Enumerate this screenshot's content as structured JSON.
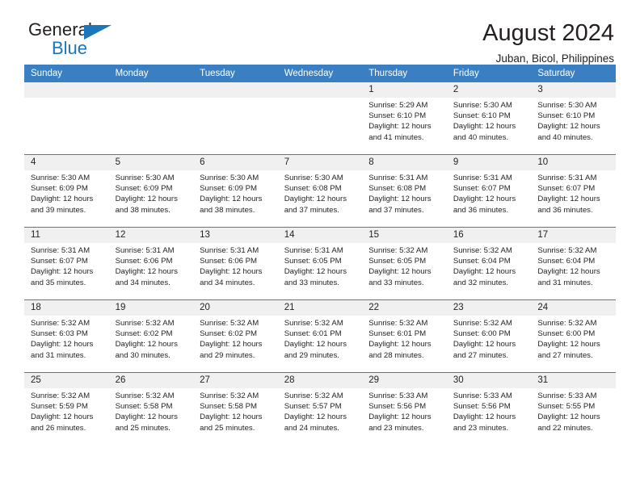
{
  "brand": {
    "name_primary": "General",
    "name_secondary": "Blue",
    "triangle_icon": "brand-triangle-icon",
    "accent_color": "#1b76bc"
  },
  "header": {
    "title": "August 2024",
    "subtitle": "Juban, Bicol, Philippines"
  },
  "calendar": {
    "header_color": "#3a7fc1",
    "daynum_band_color": "#f0f0f0",
    "weekday_headers": [
      "Sunday",
      "Monday",
      "Tuesday",
      "Wednesday",
      "Thursday",
      "Friday",
      "Saturday"
    ],
    "weeks": [
      [
        {
          "day": "",
          "blank": true,
          "sunrise": "",
          "sunset": "",
          "daylight_1": "",
          "daylight_2": ""
        },
        {
          "day": "",
          "blank": true,
          "sunrise": "",
          "sunset": "",
          "daylight_1": "",
          "daylight_2": ""
        },
        {
          "day": "",
          "blank": true,
          "sunrise": "",
          "sunset": "",
          "daylight_1": "",
          "daylight_2": ""
        },
        {
          "day": "",
          "blank": true,
          "sunrise": "",
          "sunset": "",
          "daylight_1": "",
          "daylight_2": ""
        },
        {
          "day": "1",
          "blank": false,
          "sunrise": "Sunrise: 5:29 AM",
          "sunset": "Sunset: 6:10 PM",
          "daylight_1": "Daylight: 12 hours",
          "daylight_2": "and 41 minutes."
        },
        {
          "day": "2",
          "blank": false,
          "sunrise": "Sunrise: 5:30 AM",
          "sunset": "Sunset: 6:10 PM",
          "daylight_1": "Daylight: 12 hours",
          "daylight_2": "and 40 minutes."
        },
        {
          "day": "3",
          "blank": false,
          "sunrise": "Sunrise: 5:30 AM",
          "sunset": "Sunset: 6:10 PM",
          "daylight_1": "Daylight: 12 hours",
          "daylight_2": "and 40 minutes."
        }
      ],
      [
        {
          "day": "4",
          "blank": false,
          "sunrise": "Sunrise: 5:30 AM",
          "sunset": "Sunset: 6:09 PM",
          "daylight_1": "Daylight: 12 hours",
          "daylight_2": "and 39 minutes."
        },
        {
          "day": "5",
          "blank": false,
          "sunrise": "Sunrise: 5:30 AM",
          "sunset": "Sunset: 6:09 PM",
          "daylight_1": "Daylight: 12 hours",
          "daylight_2": "and 38 minutes."
        },
        {
          "day": "6",
          "blank": false,
          "sunrise": "Sunrise: 5:30 AM",
          "sunset": "Sunset: 6:09 PM",
          "daylight_1": "Daylight: 12 hours",
          "daylight_2": "and 38 minutes."
        },
        {
          "day": "7",
          "blank": false,
          "sunrise": "Sunrise: 5:30 AM",
          "sunset": "Sunset: 6:08 PM",
          "daylight_1": "Daylight: 12 hours",
          "daylight_2": "and 37 minutes."
        },
        {
          "day": "8",
          "blank": false,
          "sunrise": "Sunrise: 5:31 AM",
          "sunset": "Sunset: 6:08 PM",
          "daylight_1": "Daylight: 12 hours",
          "daylight_2": "and 37 minutes."
        },
        {
          "day": "9",
          "blank": false,
          "sunrise": "Sunrise: 5:31 AM",
          "sunset": "Sunset: 6:07 PM",
          "daylight_1": "Daylight: 12 hours",
          "daylight_2": "and 36 minutes."
        },
        {
          "day": "10",
          "blank": false,
          "sunrise": "Sunrise: 5:31 AM",
          "sunset": "Sunset: 6:07 PM",
          "daylight_1": "Daylight: 12 hours",
          "daylight_2": "and 36 minutes."
        }
      ],
      [
        {
          "day": "11",
          "blank": false,
          "sunrise": "Sunrise: 5:31 AM",
          "sunset": "Sunset: 6:07 PM",
          "daylight_1": "Daylight: 12 hours",
          "daylight_2": "and 35 minutes."
        },
        {
          "day": "12",
          "blank": false,
          "sunrise": "Sunrise: 5:31 AM",
          "sunset": "Sunset: 6:06 PM",
          "daylight_1": "Daylight: 12 hours",
          "daylight_2": "and 34 minutes."
        },
        {
          "day": "13",
          "blank": false,
          "sunrise": "Sunrise: 5:31 AM",
          "sunset": "Sunset: 6:06 PM",
          "daylight_1": "Daylight: 12 hours",
          "daylight_2": "and 34 minutes."
        },
        {
          "day": "14",
          "blank": false,
          "sunrise": "Sunrise: 5:31 AM",
          "sunset": "Sunset: 6:05 PM",
          "daylight_1": "Daylight: 12 hours",
          "daylight_2": "and 33 minutes."
        },
        {
          "day": "15",
          "blank": false,
          "sunrise": "Sunrise: 5:32 AM",
          "sunset": "Sunset: 6:05 PM",
          "daylight_1": "Daylight: 12 hours",
          "daylight_2": "and 33 minutes."
        },
        {
          "day": "16",
          "blank": false,
          "sunrise": "Sunrise: 5:32 AM",
          "sunset": "Sunset: 6:04 PM",
          "daylight_1": "Daylight: 12 hours",
          "daylight_2": "and 32 minutes."
        },
        {
          "day": "17",
          "blank": false,
          "sunrise": "Sunrise: 5:32 AM",
          "sunset": "Sunset: 6:04 PM",
          "daylight_1": "Daylight: 12 hours",
          "daylight_2": "and 31 minutes."
        }
      ],
      [
        {
          "day": "18",
          "blank": false,
          "sunrise": "Sunrise: 5:32 AM",
          "sunset": "Sunset: 6:03 PM",
          "daylight_1": "Daylight: 12 hours",
          "daylight_2": "and 31 minutes."
        },
        {
          "day": "19",
          "blank": false,
          "sunrise": "Sunrise: 5:32 AM",
          "sunset": "Sunset: 6:02 PM",
          "daylight_1": "Daylight: 12 hours",
          "daylight_2": "and 30 minutes."
        },
        {
          "day": "20",
          "blank": false,
          "sunrise": "Sunrise: 5:32 AM",
          "sunset": "Sunset: 6:02 PM",
          "daylight_1": "Daylight: 12 hours",
          "daylight_2": "and 29 minutes."
        },
        {
          "day": "21",
          "blank": false,
          "sunrise": "Sunrise: 5:32 AM",
          "sunset": "Sunset: 6:01 PM",
          "daylight_1": "Daylight: 12 hours",
          "daylight_2": "and 29 minutes."
        },
        {
          "day": "22",
          "blank": false,
          "sunrise": "Sunrise: 5:32 AM",
          "sunset": "Sunset: 6:01 PM",
          "daylight_1": "Daylight: 12 hours",
          "daylight_2": "and 28 minutes."
        },
        {
          "day": "23",
          "blank": false,
          "sunrise": "Sunrise: 5:32 AM",
          "sunset": "Sunset: 6:00 PM",
          "daylight_1": "Daylight: 12 hours",
          "daylight_2": "and 27 minutes."
        },
        {
          "day": "24",
          "blank": false,
          "sunrise": "Sunrise: 5:32 AM",
          "sunset": "Sunset: 6:00 PM",
          "daylight_1": "Daylight: 12 hours",
          "daylight_2": "and 27 minutes."
        }
      ],
      [
        {
          "day": "25",
          "blank": false,
          "sunrise": "Sunrise: 5:32 AM",
          "sunset": "Sunset: 5:59 PM",
          "daylight_1": "Daylight: 12 hours",
          "daylight_2": "and 26 minutes."
        },
        {
          "day": "26",
          "blank": false,
          "sunrise": "Sunrise: 5:32 AM",
          "sunset": "Sunset: 5:58 PM",
          "daylight_1": "Daylight: 12 hours",
          "daylight_2": "and 25 minutes."
        },
        {
          "day": "27",
          "blank": false,
          "sunrise": "Sunrise: 5:32 AM",
          "sunset": "Sunset: 5:58 PM",
          "daylight_1": "Daylight: 12 hours",
          "daylight_2": "and 25 minutes."
        },
        {
          "day": "28",
          "blank": false,
          "sunrise": "Sunrise: 5:32 AM",
          "sunset": "Sunset: 5:57 PM",
          "daylight_1": "Daylight: 12 hours",
          "daylight_2": "and 24 minutes."
        },
        {
          "day": "29",
          "blank": false,
          "sunrise": "Sunrise: 5:33 AM",
          "sunset": "Sunset: 5:56 PM",
          "daylight_1": "Daylight: 12 hours",
          "daylight_2": "and 23 minutes."
        },
        {
          "day": "30",
          "blank": false,
          "sunrise": "Sunrise: 5:33 AM",
          "sunset": "Sunset: 5:56 PM",
          "daylight_1": "Daylight: 12 hours",
          "daylight_2": "and 23 minutes."
        },
        {
          "day": "31",
          "blank": false,
          "sunrise": "Sunrise: 5:33 AM",
          "sunset": "Sunset: 5:55 PM",
          "daylight_1": "Daylight: 12 hours",
          "daylight_2": "and 22 minutes."
        }
      ]
    ]
  }
}
